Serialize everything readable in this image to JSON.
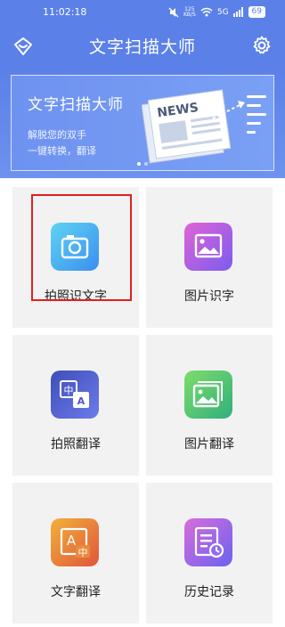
{
  "status_bar": {
    "time": "11:02:18",
    "net_speed": "125",
    "net_unit": "KB/S",
    "signal": "5G",
    "battery": "69"
  },
  "header": {
    "title": "文字扫描大师"
  },
  "banner": {
    "title": "文字扫描大师",
    "subtitle_line1": "解脱您的双手",
    "subtitle_line2": "一键转换，翻译",
    "news_text": "NEWS",
    "pages": 2,
    "active_page": 1
  },
  "features": [
    {
      "label": "拍照识文字",
      "icon": "camera-icon"
    },
    {
      "label": "图片识字",
      "icon": "image-icon"
    },
    {
      "label": "拍照翻译",
      "icon": "translate-icon"
    },
    {
      "label": "图片翻译",
      "icon": "gallery-icon"
    },
    {
      "label": "文字翻译",
      "icon": "text-translate-icon"
    },
    {
      "label": "历史记录",
      "icon": "history-icon"
    }
  ],
  "colors": {
    "header_bg": "#5b80e8",
    "highlight": "#e02020",
    "tile_bg": "#f2f2f2"
  }
}
